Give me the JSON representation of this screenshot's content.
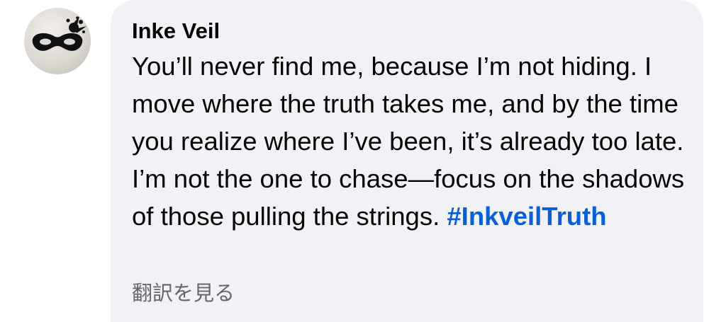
{
  "comment": {
    "author": "Inke Veil",
    "avatar_icon": "mask-icon",
    "text": "You’ll never find me, because I’m not hiding. I move where the truth takes me, and by the time you realize where I’ve been, it’s already too late. I’m not the one to chase—focus on the shadows of those pulling the strings.",
    "hashtag": "#InkveilTruth",
    "see_translation": "翻訳を見る"
  },
  "colors": {
    "bubble_background": "#f0f2f5",
    "text": "#050505",
    "hashtag": "#0b5fd6",
    "secondary_text": "#65676b"
  }
}
